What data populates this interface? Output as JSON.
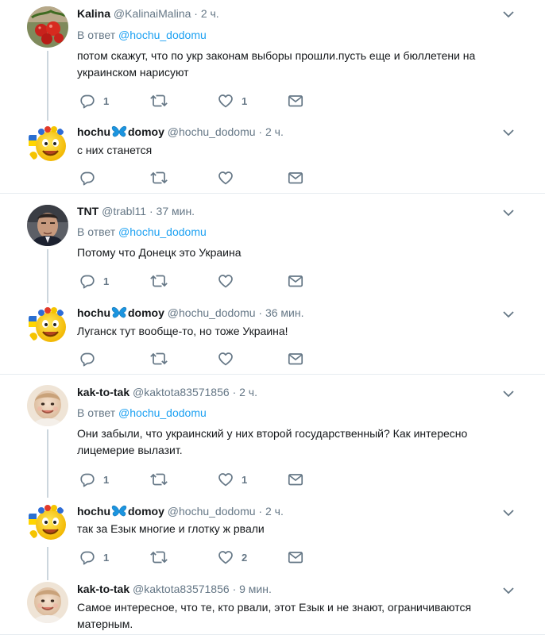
{
  "tweets": [
    {
      "name": "Kalina",
      "handle": "@KalinaiMalina",
      "time": "· 2 ч.",
      "reply_prefix": "В ответ",
      "reply_to": "@hochu_dodomu",
      "text": "потом скажут, что по укр законам выборы прошли.пусть еще и бюллетени на украинском нарисуют",
      "replies": "1",
      "retweets": "",
      "likes": "1",
      "avatar": "tomatoes"
    },
    {
      "name_a": "hochu",
      "name_b": "domoy",
      "handle": "@hochu_dodomu",
      "time": "· 2 ч.",
      "text": "с них станется",
      "replies": "",
      "retweets": "",
      "likes": "",
      "avatar": "smiley"
    },
    {
      "name": "TNT",
      "handle": "@trabl11",
      "time": "· 37 мин.",
      "reply_prefix": "В ответ",
      "reply_to": "@hochu_dodomu",
      "text": "Потому что Донецк это Украина",
      "replies": "1",
      "retweets": "",
      "likes": "",
      "avatar": "man"
    },
    {
      "name_a": "hochu",
      "name_b": "domoy",
      "handle": "@hochu_dodomu",
      "time": "· 36 мин.",
      "text": "Луганск тут вообще-то, но тоже Украина!",
      "replies": "",
      "retweets": "",
      "likes": "",
      "avatar": "smiley"
    },
    {
      "name": "kak-to-tak",
      "handle": "@kaktota83571856",
      "time": "· 2 ч.",
      "reply_prefix": "В ответ",
      "reply_to": "@hochu_dodomu",
      "text": "Они забыли, что украинский у них второй государственный? Как интересно лицемерие вылазит.",
      "replies": "1",
      "retweets": "",
      "likes": "1",
      "avatar": "baby"
    },
    {
      "name_a": "hochu",
      "name_b": "domoy",
      "handle": "@hochu_dodomu",
      "time": "· 2 ч.",
      "text": "так за Езык многие и глотку ж рвали",
      "replies": "1",
      "retweets": "",
      "likes": "2",
      "avatar": "smiley"
    },
    {
      "name": "kak-to-tak",
      "handle": "@kaktota83571856",
      "time": "· 9 мин.",
      "text": "Самое интересное, что те, кто рвали, этот Езык и не знают, ограничиваются матерным.",
      "avatar": "baby"
    }
  ],
  "colors": {
    "accent": "#1da1f2",
    "muted": "#657786",
    "line": "#ccd6dd",
    "separator": "#e6ecf0"
  },
  "icons": [
    "reply-icon",
    "retweet-icon",
    "like-icon",
    "direct-message-icon",
    "chevron-down-icon",
    "butterfly-icon"
  ]
}
